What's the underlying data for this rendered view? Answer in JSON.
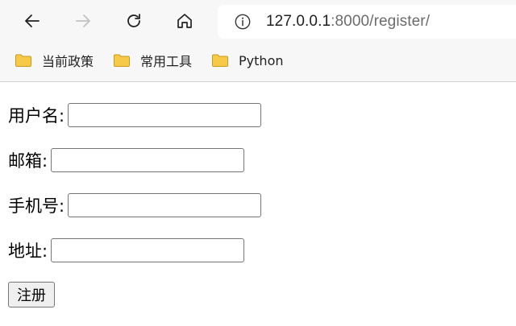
{
  "browser": {
    "url_host": "127.0.0.1",
    "url_path": ":8000/register/"
  },
  "bookmarks": [
    {
      "label": "当前政策"
    },
    {
      "label": "常用工具"
    },
    {
      "label": "Python"
    }
  ],
  "form": {
    "username_label": "用户名:",
    "email_label": "邮箱:",
    "phone_label": "手机号:",
    "address_label": "地址:",
    "username_value": "",
    "email_value": "",
    "phone_value": "",
    "address_value": "",
    "submit_label": "注册"
  },
  "colors": {
    "folder": "#f7c948",
    "chrome_bg": "#f7f7f7"
  }
}
